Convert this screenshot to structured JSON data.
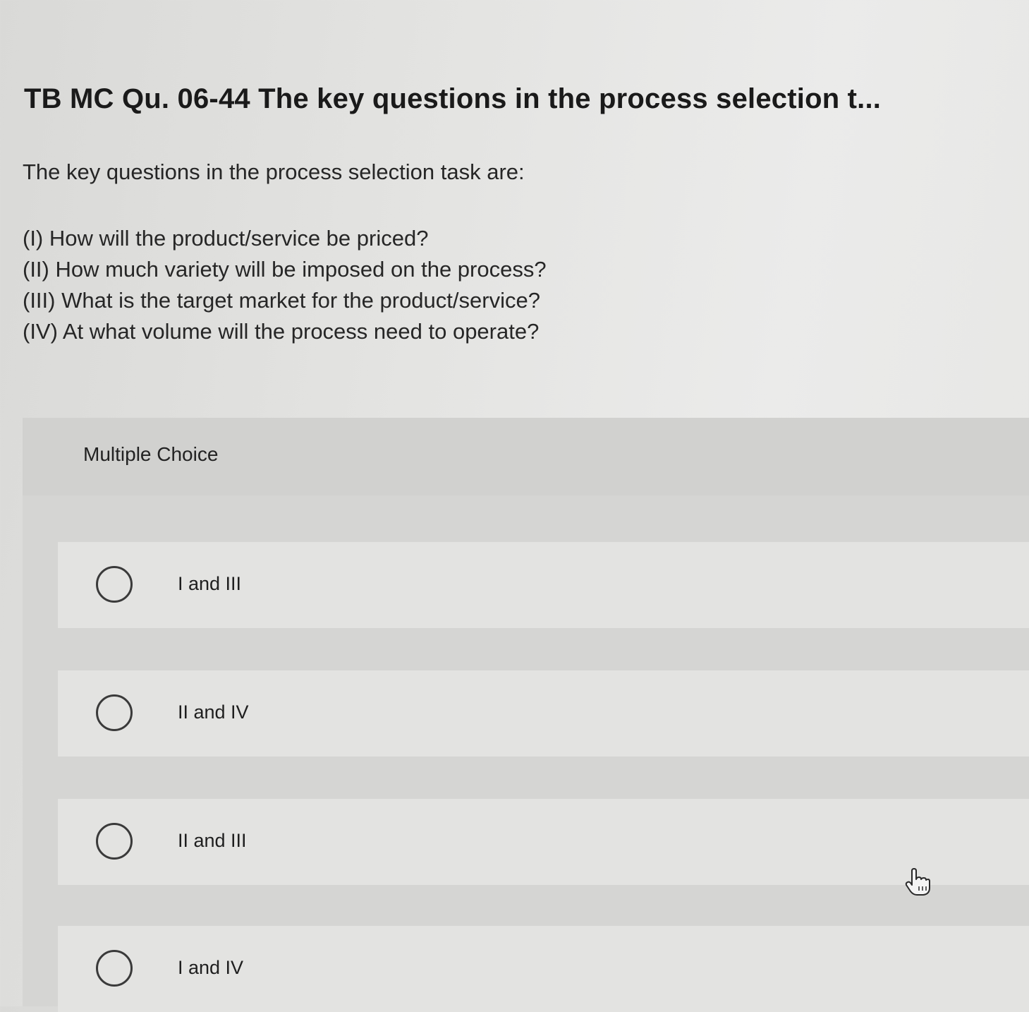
{
  "question": {
    "title": "TB MC Qu. 06-44 The key questions in the process selection t...",
    "prompt": "The key questions in the process selection task are:",
    "statements": [
      "(I) How will the product/service be priced?",
      "(II) How much variety will be imposed on the process?",
      "(III) What is the target market for the product/service?",
      "(IV) At what volume will the process need to operate?"
    ]
  },
  "answer_section": {
    "label": "Multiple Choice",
    "options": [
      {
        "label": "I and III",
        "selected": false
      },
      {
        "label": "II and IV",
        "selected": false
      },
      {
        "label": "II and III",
        "selected": false
      },
      {
        "label": "I and IV",
        "selected": false
      }
    ]
  },
  "cursor": {
    "icon": "hand-pointer-icon"
  }
}
